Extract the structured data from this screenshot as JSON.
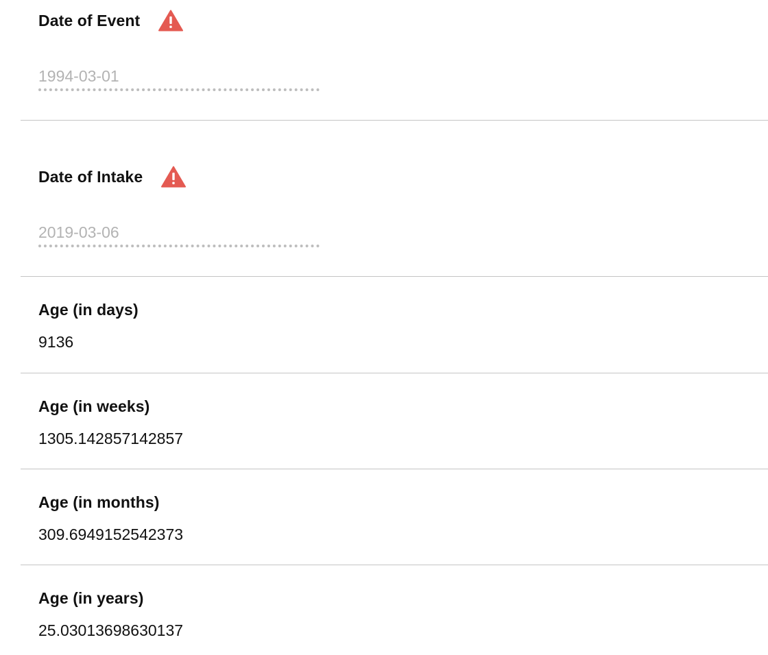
{
  "fields": {
    "date_of_event": {
      "label": "Date of Event",
      "value": "1994-03-01",
      "icon": "warning-icon"
    },
    "date_of_intake": {
      "label": "Date of Intake",
      "value": "2019-03-06",
      "icon": "warning-icon"
    },
    "age_days": {
      "label": "Age (in days)",
      "value": "9136"
    },
    "age_weeks": {
      "label": "Age (in weeks)",
      "value": "1305.142857142857"
    },
    "age_months": {
      "label": "Age (in months)",
      "value": "309.6949152542373"
    },
    "age_years": {
      "label": "Age (in years)",
      "value": "25.03013698630137"
    }
  },
  "colors": {
    "warning": "#e45a52",
    "divider": "#c4c4c4",
    "placeholder_text": "#b3b3b3",
    "dotted_underline": "#bdbdbd"
  }
}
